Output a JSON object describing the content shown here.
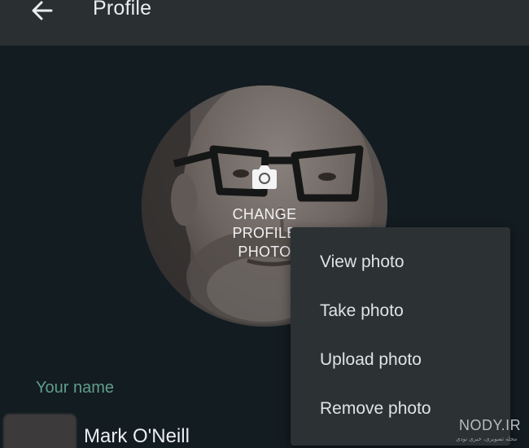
{
  "header": {
    "title": "Profile",
    "back_icon": "arrow-left-icon"
  },
  "avatar": {
    "camera_icon": "camera-icon",
    "change_text": "CHANGE\nPROFILE\nPHOTO"
  },
  "name_section": {
    "label": "Your name",
    "value": "Mark O'Neill"
  },
  "photo_menu": {
    "items": [
      {
        "label": "View photo"
      },
      {
        "label": "Take photo"
      },
      {
        "label": "Upload photo"
      },
      {
        "label": "Remove photo"
      }
    ]
  },
  "watermark": {
    "main": "NODY.IR",
    "sub": "مجله تصویری، خبری نودی"
  },
  "colors": {
    "background": "#131c21",
    "header": "#2a2f32",
    "menu": "#2c3134",
    "label_green": "#5f9e8a",
    "text_primary": "#e9edef"
  }
}
